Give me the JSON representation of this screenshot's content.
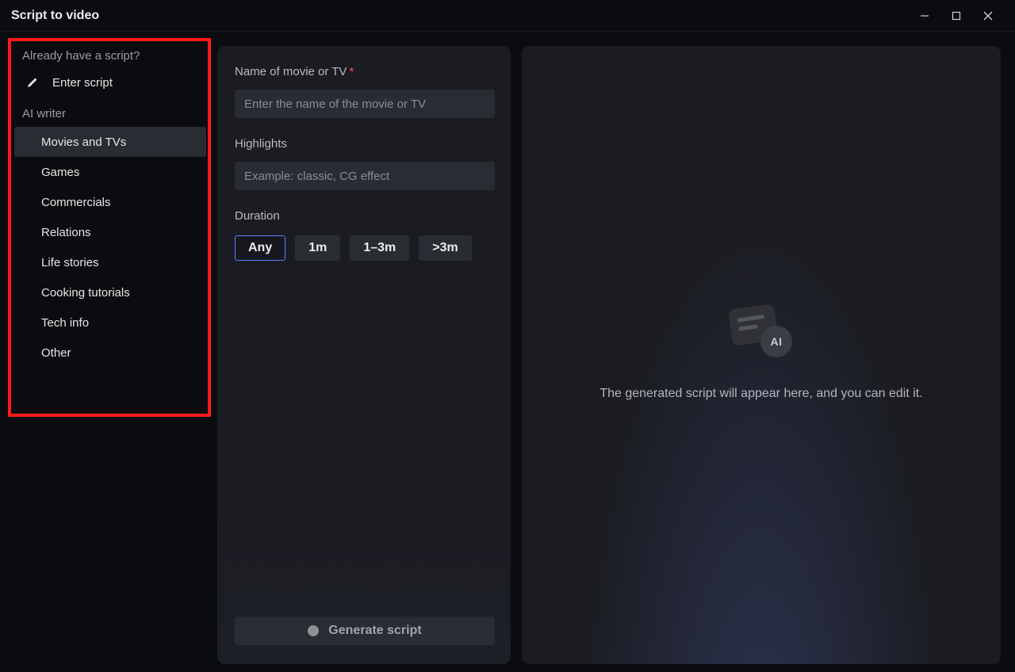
{
  "window": {
    "title": "Script to video"
  },
  "sidebar": {
    "section_script_label": "Already have a script?",
    "enter_script_label": "Enter script",
    "section_ai_label": "AI writer",
    "items": [
      {
        "label": "Movies and TVs",
        "active": true
      },
      {
        "label": "Games",
        "active": false
      },
      {
        "label": "Commercials",
        "active": false
      },
      {
        "label": "Relations",
        "active": false
      },
      {
        "label": "Life stories",
        "active": false
      },
      {
        "label": "Cooking tutorials",
        "active": false
      },
      {
        "label": "Tech info",
        "active": false
      },
      {
        "label": "Other",
        "active": false
      }
    ]
  },
  "form": {
    "name_label": "Name of movie or TV",
    "name_required_marker": "*",
    "name_placeholder": "Enter the name of the movie or TV",
    "name_value": "",
    "highlights_label": "Highlights",
    "highlights_placeholder": "Example: classic, CG effect",
    "highlights_value": "",
    "duration_label": "Duration",
    "duration_options": [
      {
        "label": "Any",
        "active": true
      },
      {
        "label": "1m",
        "active": false
      },
      {
        "label": "1–3m",
        "active": false
      },
      {
        "label": ">3m",
        "active": false
      }
    ],
    "generate_label": "Generate script"
  },
  "preview": {
    "placeholder_text": "The generated script will appear here, and you can edit it.",
    "ai_badge_text": "AI"
  }
}
